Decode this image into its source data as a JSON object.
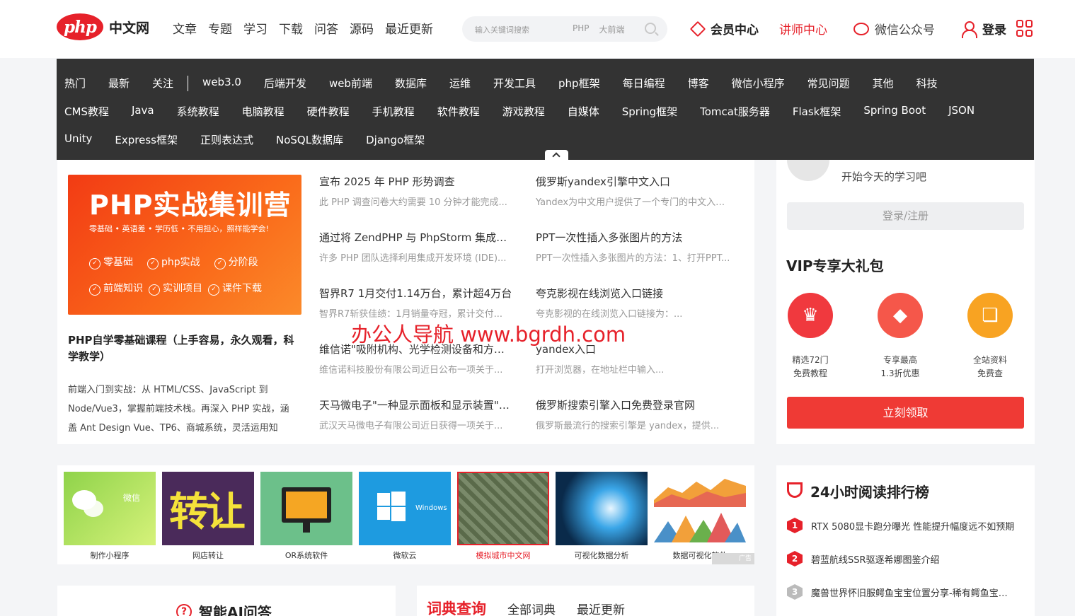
{
  "header": {
    "logo_mark": "php",
    "logo_text": "中文网",
    "nav": [
      "文章",
      "专题",
      "学习",
      "下载",
      "问答",
      "源码",
      "最近更新"
    ],
    "search": {
      "placeholder": "输入关键词搜索",
      "tags": [
        "PHP",
        "大前端"
      ]
    },
    "member": "会员中心",
    "lecturer": "讲师中心",
    "wechat": "微信公众号",
    "login": "登录"
  },
  "categories": {
    "row1": [
      "热门",
      "最新",
      "关注",
      "web3.0",
      "后端开发",
      "web前端",
      "数据库",
      "运维",
      "开发工具",
      "php框架",
      "每日编程",
      "博客",
      "微信小程序",
      "常见问题",
      "其他",
      "科技"
    ],
    "row2": [
      "CMS教程",
      "Java",
      "系统教程",
      "电脑教程",
      "硬件教程",
      "手机教程",
      "软件教程",
      "游戏教程",
      "自媒体",
      "Spring框架",
      "Tomcat服务器",
      "Flask框架",
      "Spring Boot",
      "JSON"
    ],
    "row3": [
      "Unity",
      "Express框架",
      "正则表达式",
      "NoSQL数据库",
      "Django框架"
    ]
  },
  "promo": {
    "title": "PHP实战集训营",
    "subtitle": "零基础 • 英语差 • 学历低 • 不用担心，照样能学会!",
    "badges_row1": [
      "零基础",
      "php实战",
      "分阶段"
    ],
    "badges_row2": [
      "前端知识",
      "实训项目",
      "课件下载"
    ]
  },
  "course": {
    "title": "PHP自学零基础课程（上手容易，永久观看，科学教学）",
    "desc": "前端入门到实战：从 HTML/CSS、JavaScript 到 Node/Vue3，掌握前端技术栈。再深入 PHP 实战，涵盖 Ant Design Vue、TP6、商城系统，灵活运用知"
  },
  "articles_left": [
    {
      "title": "宣布 2025 年 PHP 形势调查",
      "desc": "此 PHP 调查问卷大约需要 10 分钟才能完成..."
    },
    {
      "title": "通过将 ZendPHP 与 PhpStorm 集成提高 PHP 开发效率",
      "desc": "许多 PHP 团队选择利用集成开发环境 (IDE)..."
    },
    {
      "title": "智界R7 1月交付1.14万台，累计超4万台",
      "desc": "智界R7斩获佳绩：1月销量夺冠，累计交付..."
    },
    {
      "title": "维信诺\"吸附机构、光学检测设备和方法\"专利获授权",
      "desc": "维信诺科技股份有限公司近日公布一项关于..."
    },
    {
      "title": "天马微电子\"一种显示面板和显示装置\"专利公布",
      "desc": "武汉天马微电子有限公司近日获得一项关于..."
    }
  ],
  "articles_right": [
    {
      "title": "俄罗斯yandex引擎中文入口",
      "desc": "Yandex为中文用户提供了一个专门的中文入口..."
    },
    {
      "title": "PPT一次性插入多张图片的方法",
      "desc": "PPT一次性插入多张图片的方法：1、打开PPT..."
    },
    {
      "title": "夸克影视在线浏览入口链接",
      "desc": "夸克影视的在线浏览入口链接为：..."
    },
    {
      "title": "yandex入口",
      "desc": "打开浏览器，在地址栏中输入..."
    },
    {
      "title": "俄罗斯搜索引擎入口免费登录官网",
      "desc": "俄罗斯最流行的搜索引擎是 yandex，提供..."
    }
  ],
  "watermark": "办公人导航 www.bgrdh.com",
  "user_panel": {
    "greeting": "开始今天的学习吧",
    "login_register": "登录/注册",
    "vip_title": "VIP专享大礼包",
    "gifts": [
      {
        "line1": "精选72门",
        "line2": "免费教程",
        "icon": "crown-icon",
        "color": "#f0393e"
      },
      {
        "line1": "专享最高",
        "line2": "1.3折优惠",
        "icon": "tag-icon",
        "color": "#f5574a"
      },
      {
        "line1": "全站资料",
        "line2": "免费查",
        "icon": "document-search-icon",
        "color": "#f8a322"
      }
    ],
    "claim": "立刻领取"
  },
  "tiles": [
    {
      "label": "制作小程序",
      "tile_text": "微信"
    },
    {
      "label": "网店转让",
      "tile_text": "转让"
    },
    {
      "label": "OR系统软件",
      "tile_text": ""
    },
    {
      "label": "微软云",
      "tile_text": "Windows"
    },
    {
      "label": "模拟城市中文网",
      "tile_text": ""
    },
    {
      "label": "可视化数据分析",
      "tile_text": ""
    },
    {
      "label": "数据可视化软件",
      "tile_text": ""
    }
  ],
  "ad_tag": "广告",
  "ranking": {
    "title": "24小时阅读排行榜",
    "items": [
      {
        "num": "1",
        "text": "RTX 5080显卡跑分曝光 性能提升幅度远不如预期"
      },
      {
        "num": "2",
        "text": "碧蓝航线SSR驱逐希娜图鉴介绍"
      },
      {
        "num": "3",
        "text": "魔兽世界怀旧服鳄鱼宝宝位置分享-稀有鳄鱼宝宝在哪"
      }
    ]
  },
  "ai": {
    "title": "智能AI问答"
  },
  "dict": {
    "tabs": [
      "词典查询",
      "全部词典",
      "最近更新"
    ]
  }
}
